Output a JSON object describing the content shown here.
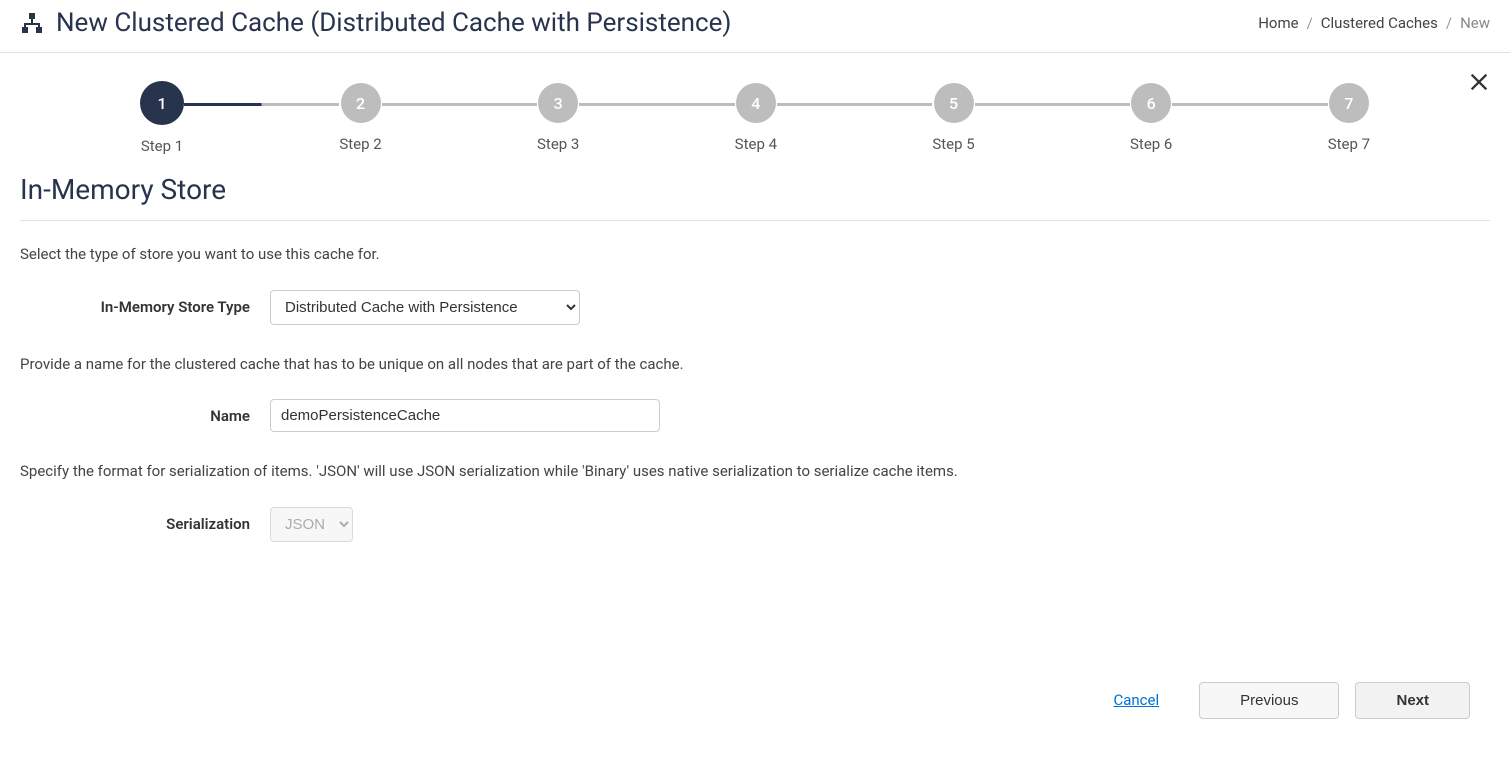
{
  "header": {
    "title": "New Clustered Cache (Distributed Cache with Persistence)"
  },
  "breadcrumb": {
    "home": "Home",
    "caches": "Clustered Caches",
    "current": "New"
  },
  "stepper": {
    "steps": [
      {
        "num": "1",
        "label": "Step 1"
      },
      {
        "num": "2",
        "label": "Step 2"
      },
      {
        "num": "3",
        "label": "Step 3"
      },
      {
        "num": "4",
        "label": "Step 4"
      },
      {
        "num": "5",
        "label": "Step 5"
      },
      {
        "num": "6",
        "label": "Step 6"
      },
      {
        "num": "7",
        "label": "Step 7"
      }
    ]
  },
  "section": {
    "heading": "In-Memory Store",
    "desc1": "Select the type of store you want to use this cache for.",
    "storeTypeLabel": "In-Memory Store Type",
    "storeTypeValue": "Distributed Cache with Persistence",
    "desc2": "Provide a name for the clustered cache that has to be unique on all nodes that are part of the cache.",
    "nameLabel": "Name",
    "nameValue": "demoPersistenceCache",
    "desc3": "Specify the format for serialization of items. 'JSON' will use JSON serialization while 'Binary' uses native serialization to serialize cache items.",
    "serializationLabel": "Serialization",
    "serializationValue": "JSON"
  },
  "footer": {
    "cancel": "Cancel",
    "previous": "Previous",
    "next": "Next"
  }
}
